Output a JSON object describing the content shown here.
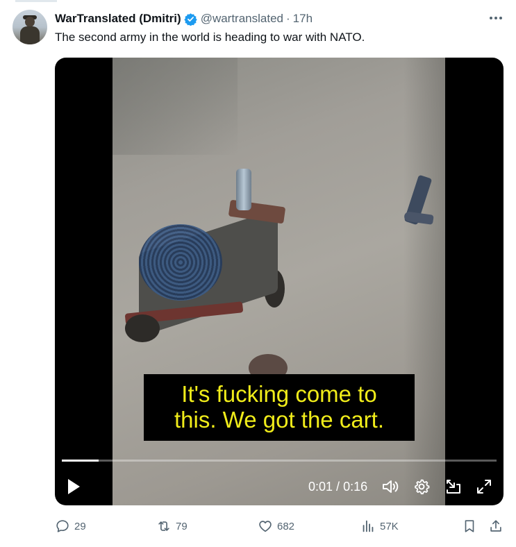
{
  "tweet": {
    "author_name": "WarTranslated (Dmitri)",
    "handle": "@wartranslated",
    "separator": "·",
    "time": "17h",
    "text": "The second army in the world is heading to war with NATO.",
    "verified_icon": "verified-badge-icon",
    "accent_color": "#1d9bf0"
  },
  "video": {
    "subtitle_line1": "It's fucking come to",
    "subtitle_line2": "this. We got the cart.",
    "current_time": "0:01",
    "duration": "0:16",
    "time_separator": " / ",
    "progress_fraction": 0.085,
    "controls": [
      "play-icon",
      "volume-icon",
      "settings-icon",
      "picture-in-picture-icon",
      "fullscreen-icon"
    ]
  },
  "actions": {
    "replies": "29",
    "reposts": "79",
    "likes": "682",
    "views": "57K"
  }
}
